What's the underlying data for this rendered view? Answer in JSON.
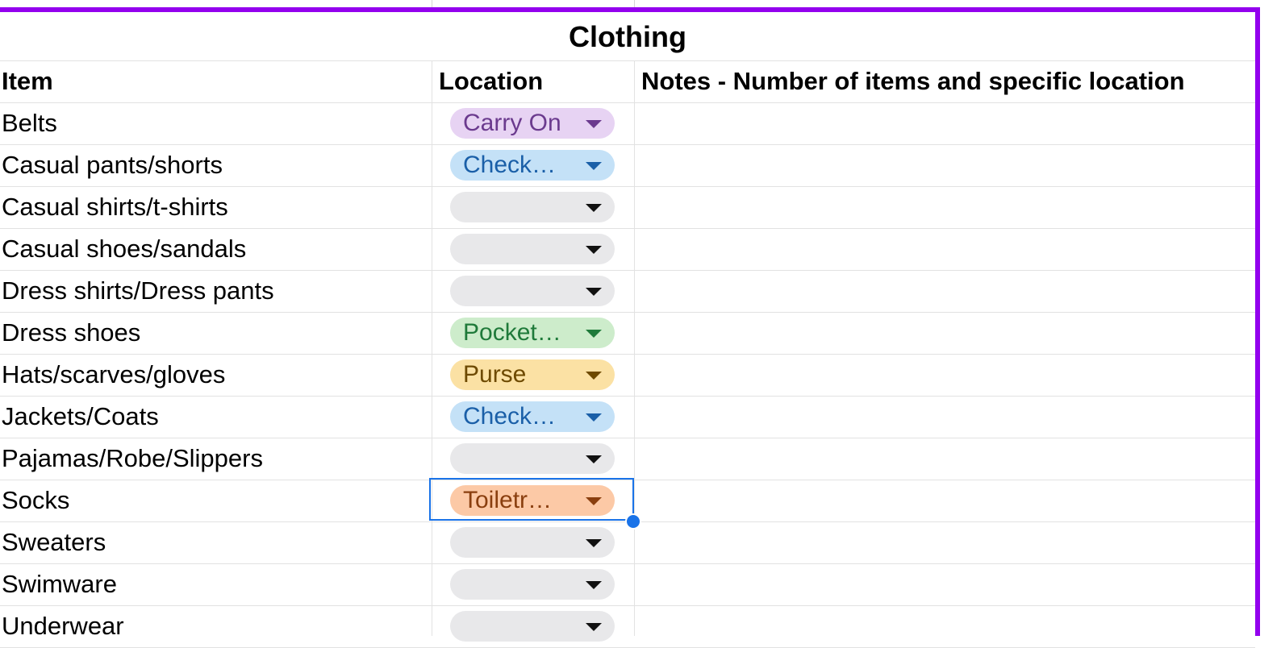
{
  "sheet": {
    "title": "Clothing",
    "headers": {
      "item": "Item",
      "location": "Location",
      "notes": "Notes - Number of items and specific location"
    },
    "rows": [
      {
        "item": "Belts",
        "location": "Carry On",
        "chip": {
          "bg": "#e7d3f3",
          "fg": "#6b3a8e",
          "arrow": "#6b3a8e"
        }
      },
      {
        "item": "Casual pants/shorts",
        "location": "Check…",
        "chip": {
          "bg": "#c4e1f7",
          "fg": "#1a5fa8",
          "arrow": "#1a5fa8"
        }
      },
      {
        "item": "Casual shirts/t-shirts",
        "location": "",
        "chip": {
          "bg": "#e8e8ea",
          "fg": "#111111",
          "arrow": "#111111"
        }
      },
      {
        "item": "Casual shoes/sandals",
        "location": "",
        "chip": {
          "bg": "#e8e8ea",
          "fg": "#111111",
          "arrow": "#111111"
        }
      },
      {
        "item": "Dress shirts/Dress pants",
        "location": "",
        "chip": {
          "bg": "#e8e8ea",
          "fg": "#111111",
          "arrow": "#111111"
        }
      },
      {
        "item": "Dress shoes",
        "location": "Pocket…",
        "chip": {
          "bg": "#cdeccb",
          "fg": "#1f7a3a",
          "arrow": "#1f7a3a"
        }
      },
      {
        "item": "Hats/scarves/gloves",
        "location": "Purse",
        "chip": {
          "bg": "#fbe1a4",
          "fg": "#6e4a00",
          "arrow": "#6e4a00"
        }
      },
      {
        "item": "Jackets/Coats",
        "location": "Check…",
        "chip": {
          "bg": "#c4e1f7",
          "fg": "#1a5fa8",
          "arrow": "#1a5fa8"
        }
      },
      {
        "item": "Pajamas/Robe/Slippers",
        "location": "",
        "chip": {
          "bg": "#e8e8ea",
          "fg": "#111111",
          "arrow": "#111111"
        }
      },
      {
        "item": "Socks",
        "location": "Toiletr…",
        "chip": {
          "bg": "#fcc9a6",
          "fg": "#8a3f0f",
          "arrow": "#8a3f0f"
        }
      },
      {
        "item": "Sweaters",
        "location": "",
        "chip": {
          "bg": "#e8e8ea",
          "fg": "#111111",
          "arrow": "#111111"
        }
      },
      {
        "item": "Swimware",
        "location": "",
        "chip": {
          "bg": "#e8e8ea",
          "fg": "#111111",
          "arrow": "#111111"
        }
      },
      {
        "item": "Underwear",
        "location": "",
        "chip": {
          "bg": "#e8e8ea",
          "fg": "#111111",
          "arrow": "#111111"
        }
      }
    ],
    "selected_row": 9,
    "colors": {
      "frame": "#9300ee",
      "selection": "#1a73e8",
      "gridline": "#e2e2e2"
    }
  }
}
